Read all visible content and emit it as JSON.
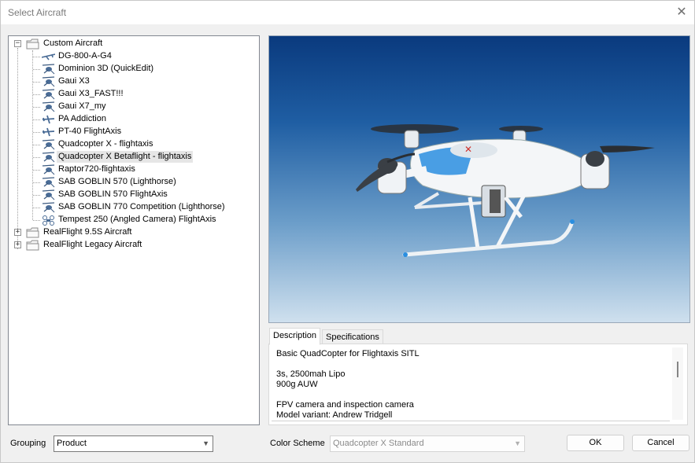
{
  "window": {
    "title": "Select Aircraft",
    "close_glyph": "✕"
  },
  "tree": {
    "custom_folder": "Custom Aircraft",
    "custom_items": [
      "DG-800-A-G4",
      "Dominion 3D (QuickEdit)",
      "Gaui X3",
      "Gaui X3_FAST!!!",
      "Gaui X7_my",
      "PA Addiction",
      "PT-40 FlightAxis",
      "Quadcopter X - flightaxis",
      "Quadcopter X Betaflight - flightaxis",
      "Raptor720-flightaxis",
      "SAB GOBLIN 570 (Lighthorse)",
      "SAB GOBLIN 570 FlightAxis",
      "SAB GOBLIN 770 Competition (Lighthorse)",
      "Tempest 250 (Angled Camera) FlightAxis"
    ],
    "item_icons": [
      "glider-icon",
      "heli-icon",
      "heli-icon",
      "heli-icon",
      "heli-icon",
      "plane-icon",
      "plane-icon",
      "heli-icon",
      "heli-icon",
      "heli-icon",
      "heli-icon",
      "heli-icon",
      "heli-icon",
      "quad-icon"
    ],
    "selected_index": 8,
    "other_folders": [
      "RealFlight 9.5S Aircraft",
      "RealFlight Legacy Aircraft"
    ],
    "expanded_glyph": "−",
    "collapsed_glyph": "+"
  },
  "tabs": {
    "description": "Description",
    "specifications": "Specifications",
    "active": "description"
  },
  "description": {
    "lines": [
      "Basic QuadCopter for Flightaxis SITL",
      "",
      "3s, 2500mah Lipo",
      "900g AUW",
      "",
      "FPV camera and inspection camera",
      "Model variant: Andrew Tridgell"
    ]
  },
  "grouping": {
    "label": "Grouping",
    "value": "Product"
  },
  "color_scheme": {
    "label": "Color Scheme",
    "value": "Quadcopter X Standard"
  },
  "buttons": {
    "ok": "OK",
    "cancel": "Cancel"
  },
  "colors": {
    "sky_top": "#0a3a7e",
    "sky_bottom": "#cfe0ee",
    "drone_body": "#f4f6f8",
    "drone_accent": "#2a8ee0",
    "selection_bg": "#e6e6e6"
  },
  "dropdown_glyph": "▼"
}
